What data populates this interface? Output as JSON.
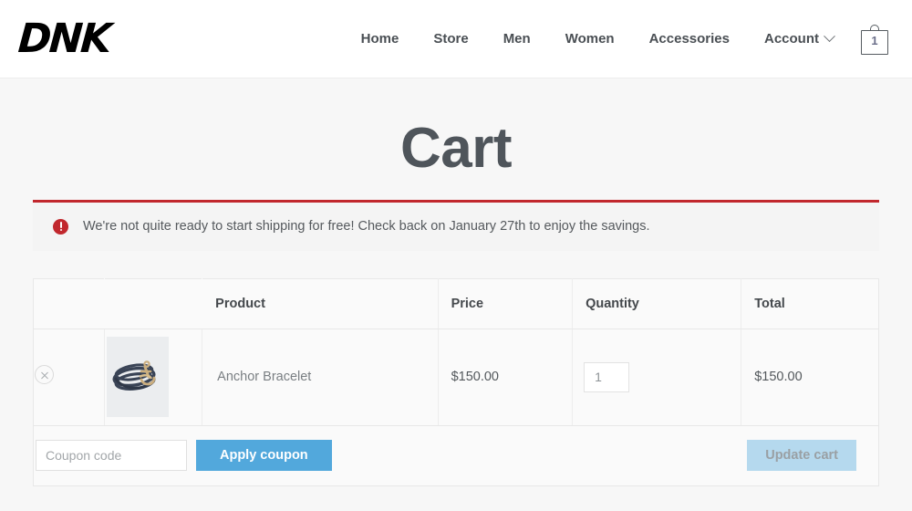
{
  "header": {
    "brand": "DNK",
    "nav": [
      {
        "label": "Home"
      },
      {
        "label": "Store"
      },
      {
        "label": "Men"
      },
      {
        "label": "Women"
      },
      {
        "label": "Accessories"
      }
    ],
    "account": {
      "label": "Account",
      "icon": "chevron-down-icon"
    },
    "cart": {
      "icon": "shopping-bag-icon",
      "count": "1"
    }
  },
  "page": {
    "title": "Cart"
  },
  "notice": {
    "icon": "error-exclamation-icon",
    "message": "We're not quite ready to start shipping for free! Check back on January 27th to enjoy the savings.",
    "accent_color": "#c1272d",
    "background": "#f4f4f4"
  },
  "cart": {
    "columns": {
      "remove": "",
      "thumbnail": "",
      "product": "Product",
      "price": "Price",
      "quantity": "Quantity",
      "total": "Total"
    },
    "items": [
      {
        "remove_icon": "remove-circle-x-icon",
        "thumbnail_alt": "Anchor Bracelet product photo",
        "name": "Anchor Bracelet",
        "price": "$150.00",
        "quantity": "1",
        "total": "$150.00"
      }
    ],
    "footer": {
      "coupon_value": "",
      "coupon_placeholder": "Coupon code",
      "apply_label": "Apply coupon",
      "update_label": "Update cart",
      "apply_color": "#52a8dc",
      "update_color": "#b5d9ee"
    }
  }
}
